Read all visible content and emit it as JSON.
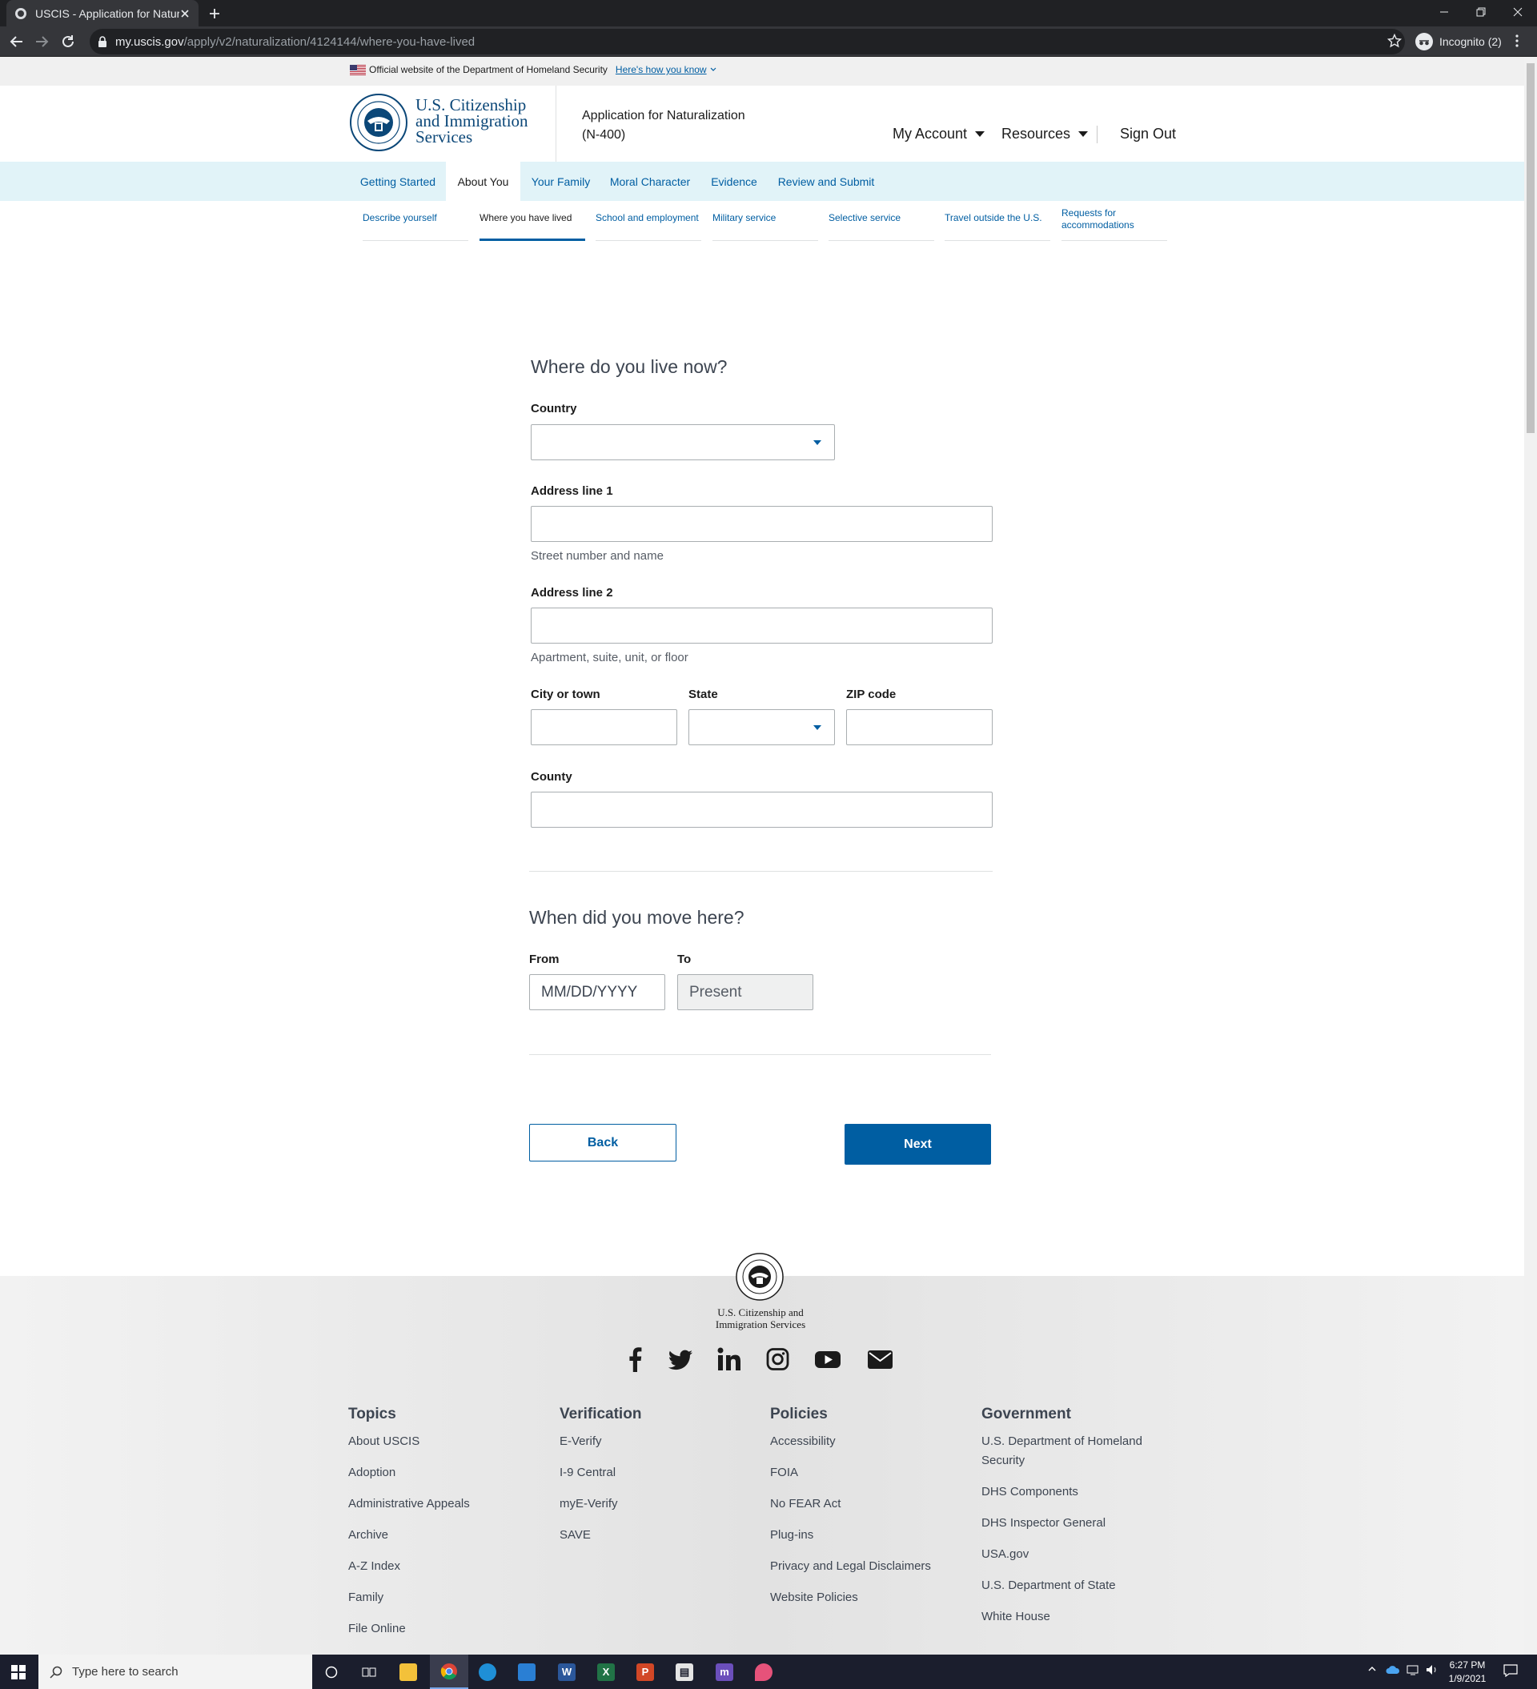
{
  "browser": {
    "tab_title": "USCIS - Application for Naturaliz",
    "url_host": "my.uscis.gov",
    "url_path": "/apply/v2/naturalization/4124144/where-you-have-lived",
    "profile_label": "Incognito (2)"
  },
  "gov_banner": {
    "text": "Official website of the Department of Homeland Security",
    "link": "Here's how you know"
  },
  "header": {
    "agency_line1": "U.S. Citizenship",
    "agency_line2": "and Immigration",
    "agency_line3": "Services",
    "app_title": "Application for Naturalization",
    "app_form": "(N-400)",
    "my_account": "My Account",
    "resources": "Resources",
    "sign_out": "Sign Out"
  },
  "steps": [
    "Getting Started",
    "About You",
    "Your Family",
    "Moral Character",
    "Evidence",
    "Review and Submit"
  ],
  "substeps": [
    "Describe yourself",
    "Where you have lived",
    "School and employment",
    "Military service",
    "Selective service",
    "Travel outside the U.S.",
    "Requests for accommodations"
  ],
  "form": {
    "heading_live": "Where do you live now?",
    "country_label": "Country",
    "country_value": "",
    "address1_label": "Address line 1",
    "address1_hint": "Street number and name",
    "address2_label": "Address line 2",
    "address2_hint": "Apartment, suite, unit, or floor",
    "city_label": "City or town",
    "state_label": "State",
    "zip_label": "ZIP code",
    "county_label": "County",
    "heading_move": "When did you move here?",
    "from_label": "From",
    "from_placeholder": "MM/DD/YYYY",
    "to_label": "To",
    "to_value": "Present",
    "back_button": "Back",
    "next_button": "Next"
  },
  "footer": {
    "agency_line1": "U.S. Citizenship and",
    "agency_line2": "Immigration Services",
    "social_icons": [
      "facebook-icon",
      "twitter-icon",
      "linkedin-icon",
      "instagram-icon",
      "youtube-icon",
      "email-icon"
    ],
    "columns": [
      {
        "heading": "Topics",
        "links": [
          "About USCIS",
          "Adoption",
          "Administrative Appeals",
          "Archive",
          "A-Z Index",
          "Family",
          "File Online"
        ]
      },
      {
        "heading": "Verification",
        "links": [
          "E-Verify",
          "I-9 Central",
          "myE-Verify",
          "SAVE"
        ]
      },
      {
        "heading": "Policies",
        "links": [
          "Accessibility",
          "FOIA",
          "No FEAR Act",
          "Plug-ins",
          "Privacy and Legal Disclaimers",
          "Website Policies"
        ]
      },
      {
        "heading": "Government",
        "links": [
          "U.S. Department of Homeland Security",
          "DHS Components",
          "DHS Inspector General",
          "USA.gov",
          "U.S. Department of State",
          "White House"
        ]
      }
    ]
  },
  "taskbar": {
    "search_placeholder": "Type here to search",
    "time": "6:27 PM",
    "date": "1/9/2021"
  },
  "colors": {
    "uscis_blue": "#005ea2",
    "step_nav_bg": "#e1f3f8",
    "agency_blue": "#0b4778"
  }
}
